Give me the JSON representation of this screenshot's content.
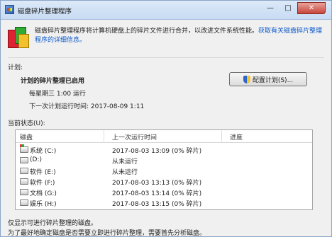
{
  "window": {
    "title": "磁盘碎片整理程序"
  },
  "titlebar": {
    "min_glyph": "—",
    "max_glyph": "□",
    "close_glyph": "✕"
  },
  "intro": {
    "text": "磁盘碎片整理程序将计算机硬盘上的碎片文件进行合并，以改进文件系统性能。",
    "link": "获取有关磁盘碎片整理程序的详细信息。"
  },
  "schedule": {
    "section_label": "计划:",
    "status": "计划的碎片整理已启用",
    "run_time": "每星期三 1:00 运行",
    "next_run": "下一次计划运行时间: 2017-08-09 1:11",
    "configure_button": "配置计划(S)..."
  },
  "current_status_label": "当前状态(U):",
  "table": {
    "columns": [
      "磁盘",
      "上一次运行时间",
      "进度"
    ],
    "rows": [
      {
        "disk": "系统 (C:)",
        "last_run": "2017-08-03 13:09 (0% 碎片)",
        "icon": "system-drive-icon"
      },
      {
        "disk": "(D:)",
        "last_run": "从未运行",
        "icon": "drive-icon"
      },
      {
        "disk": "软件 (E:)",
        "last_run": "从未运行",
        "icon": "drive-icon"
      },
      {
        "disk": "软件 (F:)",
        "last_run": "2017-08-03 13:13 (0% 碎片)",
        "icon": "drive-icon"
      },
      {
        "disk": "文档 (G:)",
        "last_run": "2017-08-03 13:14 (0% 碎片)",
        "icon": "drive-icon"
      },
      {
        "disk": "娱乐 (H:)",
        "last_run": "2017-08-03 13:15 (0% 碎片)",
        "icon": "drive-icon"
      }
    ]
  },
  "footer": {
    "line1": "仅显示可进行碎片整理的磁盘。",
    "line2": "为了最好地确定磁盘是否需要立即进行碎片整理，需要首先分析磁盘。"
  }
}
